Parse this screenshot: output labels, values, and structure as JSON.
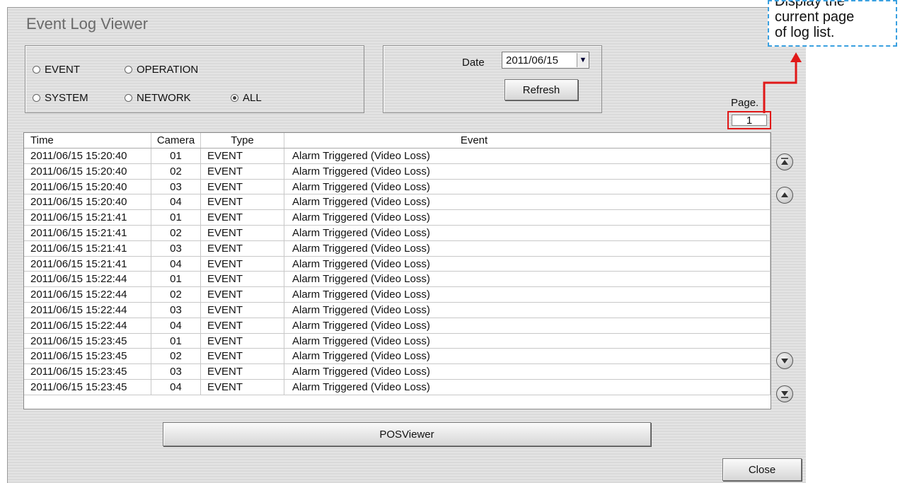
{
  "window": {
    "title": "Event Log Viewer"
  },
  "filters": {
    "event": "EVENT",
    "operation": "OPERATION",
    "system": "SYSTEM",
    "network": "NETWORK",
    "all": "ALL",
    "selected": "ALL"
  },
  "date": {
    "label": "Date",
    "value": "2011/06/15",
    "refresh_label": "Refresh"
  },
  "page": {
    "label": "Page.",
    "value": "1"
  },
  "table": {
    "columns": [
      "Time",
      "Camera",
      "Type",
      "Event"
    ],
    "rows": [
      [
        "2011/06/15 15:20:40",
        "01",
        "EVENT",
        "Alarm Triggered (Video Loss)"
      ],
      [
        "2011/06/15 15:20:40",
        "02",
        "EVENT",
        "Alarm Triggered (Video Loss)"
      ],
      [
        "2011/06/15 15:20:40",
        "03",
        "EVENT",
        "Alarm Triggered (Video Loss)"
      ],
      [
        "2011/06/15 15:20:40",
        "04",
        "EVENT",
        "Alarm Triggered (Video Loss)"
      ],
      [
        "2011/06/15 15:21:41",
        "01",
        "EVENT",
        "Alarm Triggered (Video Loss)"
      ],
      [
        "2011/06/15 15:21:41",
        "02",
        "EVENT",
        "Alarm Triggered (Video Loss)"
      ],
      [
        "2011/06/15 15:21:41",
        "03",
        "EVENT",
        "Alarm Triggered (Video Loss)"
      ],
      [
        "2011/06/15 15:21:41",
        "04",
        "EVENT",
        "Alarm Triggered (Video Loss)"
      ],
      [
        "2011/06/15 15:22:44",
        "01",
        "EVENT",
        "Alarm Triggered (Video Loss)"
      ],
      [
        "2011/06/15 15:22:44",
        "02",
        "EVENT",
        "Alarm Triggered (Video Loss)"
      ],
      [
        "2011/06/15 15:22:44",
        "03",
        "EVENT",
        "Alarm Triggered (Video Loss)"
      ],
      [
        "2011/06/15 15:22:44",
        "04",
        "EVENT",
        "Alarm Triggered (Video Loss)"
      ],
      [
        "2011/06/15 15:23:45",
        "01",
        "EVENT",
        "Alarm Triggered (Video Loss)"
      ],
      [
        "2011/06/15 15:23:45",
        "02",
        "EVENT",
        "Alarm Triggered (Video Loss)"
      ],
      [
        "2011/06/15 15:23:45",
        "03",
        "EVENT",
        "Alarm Triggered (Video Loss)"
      ],
      [
        "2011/06/15 15:23:45",
        "04",
        "EVENT",
        "Alarm Triggered (Video Loss)"
      ]
    ]
  },
  "buttons": {
    "pos_viewer": "POSViewer",
    "close": "Close"
  },
  "nav_icons": [
    "first-page-icon",
    "prev-page-icon",
    "next-page-icon",
    "last-page-icon"
  ],
  "annotation": {
    "text_lines": [
      "Display the",
      "current page",
      "of log list."
    ],
    "box_color": "#3aa0e0",
    "highlight_color": "#e01818"
  }
}
